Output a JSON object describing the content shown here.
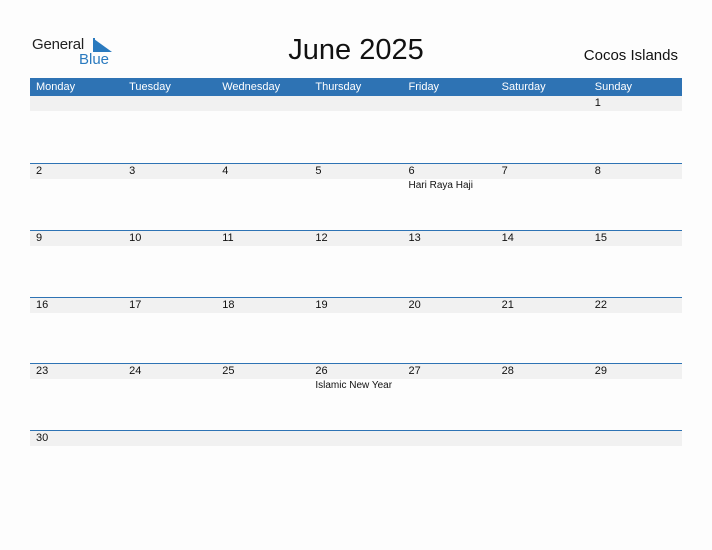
{
  "logo": {
    "word1": "General",
    "word2": "Blue"
  },
  "title": "June 2025",
  "country": "Cocos Islands",
  "weekdays": [
    "Monday",
    "Tuesday",
    "Wednesday",
    "Thursday",
    "Friday",
    "Saturday",
    "Sunday"
  ],
  "weeks": [
    {
      "days": [
        "",
        "",
        "",
        "",
        "",
        "",
        "1"
      ],
      "events": [
        "",
        "",
        "",
        "",
        "",
        "",
        ""
      ]
    },
    {
      "days": [
        "2",
        "3",
        "4",
        "5",
        "6",
        "7",
        "8"
      ],
      "events": [
        "",
        "",
        "",
        "",
        "Hari Raya Haji",
        "",
        ""
      ]
    },
    {
      "days": [
        "9",
        "10",
        "11",
        "12",
        "13",
        "14",
        "15"
      ],
      "events": [
        "",
        "",
        "",
        "",
        "",
        "",
        ""
      ]
    },
    {
      "days": [
        "16",
        "17",
        "18",
        "19",
        "20",
        "21",
        "22"
      ],
      "events": [
        "",
        "",
        "",
        "",
        "",
        "",
        ""
      ]
    },
    {
      "days": [
        "23",
        "24",
        "25",
        "26",
        "27",
        "28",
        "29"
      ],
      "events": [
        "",
        "",
        "",
        "Islamic New Year",
        "",
        "",
        ""
      ]
    },
    {
      "days": [
        "30",
        "",
        "",
        "",
        "",
        "",
        ""
      ],
      "events": [
        "",
        "",
        "",
        "",
        "",
        "",
        ""
      ]
    }
  ],
  "colors": {
    "accent": "#2e73b4",
    "row_bg": "#f1f1f1"
  }
}
